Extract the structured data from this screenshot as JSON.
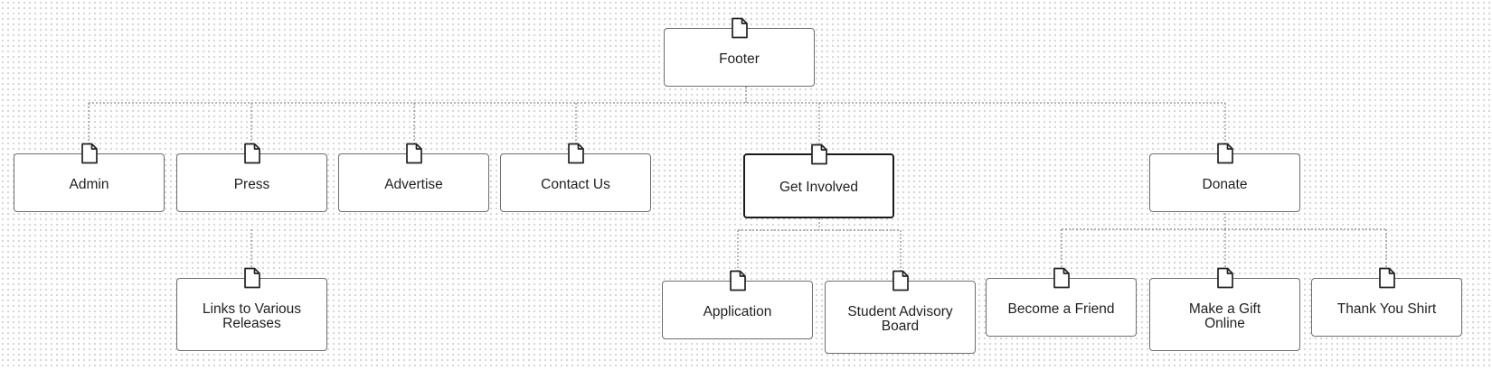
{
  "sitemap": {
    "root": {
      "id": "footer",
      "label": "Footer",
      "icon": "document-icon"
    },
    "nodes": [
      {
        "id": "admin",
        "label": "Admin",
        "icon": "document-icon",
        "parent": "footer"
      },
      {
        "id": "press",
        "label": "Press",
        "icon": "document-icon",
        "parent": "footer"
      },
      {
        "id": "advertise",
        "label": "Advertise",
        "icon": "document-icon",
        "parent": "footer"
      },
      {
        "id": "contact-us",
        "label": "Contact Us",
        "icon": "document-icon",
        "parent": "footer"
      },
      {
        "id": "get-involved",
        "label": "Get Involved",
        "icon": "document-icon",
        "parent": "footer",
        "selected": true
      },
      {
        "id": "donate",
        "label": "Donate",
        "icon": "document-icon",
        "parent": "footer"
      },
      {
        "id": "links-to-various-releases",
        "label": "Links to Various\nReleases",
        "icon": "document-icon",
        "parent": "press"
      },
      {
        "id": "application",
        "label": "Application",
        "icon": "document-icon",
        "parent": "get-involved"
      },
      {
        "id": "student-advisory-board",
        "label": "Student Advisory\nBoard",
        "icon": "document-icon",
        "parent": "get-involved"
      },
      {
        "id": "become-a-friend",
        "label": "Become a Friend",
        "icon": "document-icon",
        "parent": "donate"
      },
      {
        "id": "make-a-gift-online",
        "label": "Make a Gift\nOnline",
        "icon": "document-icon",
        "parent": "donate"
      },
      {
        "id": "thank-you-shirt",
        "label": "Thank You Shirt",
        "icon": "document-icon",
        "parent": "donate"
      }
    ]
  }
}
